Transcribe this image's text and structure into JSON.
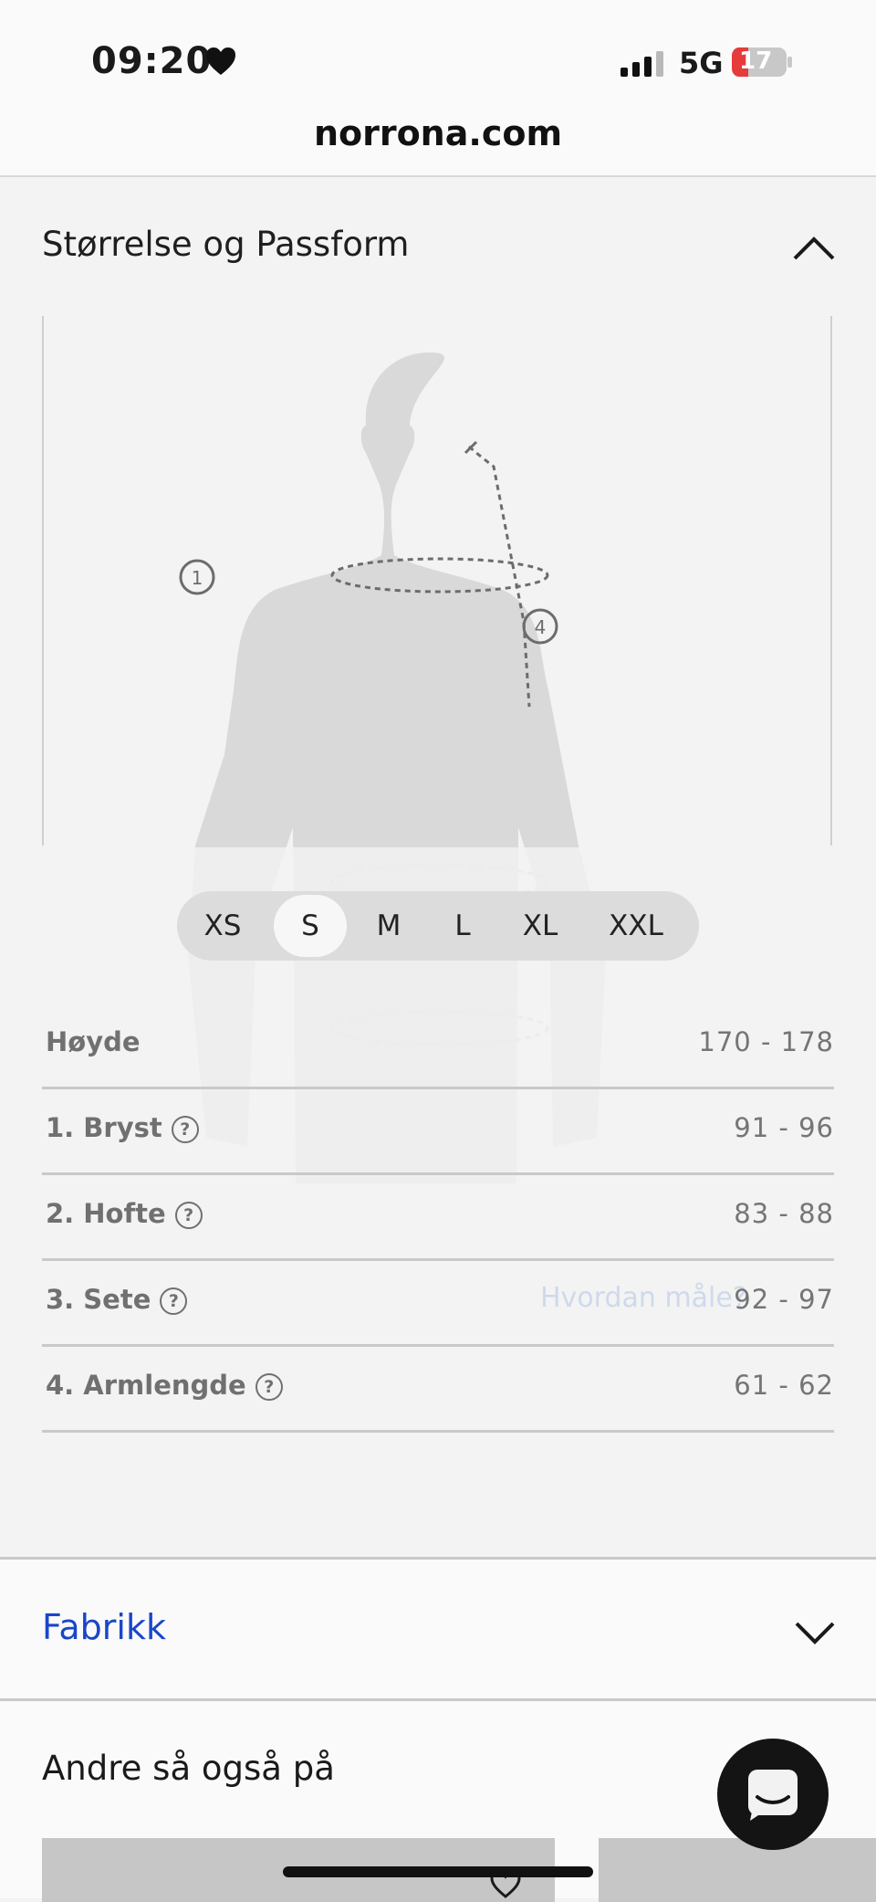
{
  "status_bar": {
    "time": "09:20",
    "network": "5G",
    "battery": "17"
  },
  "browser": {
    "url": "norrona.com"
  },
  "size_fit": {
    "title": "Størrelse og Passform",
    "help_link": "Hvordan måle?",
    "markers": [
      "1",
      "4"
    ],
    "sizes": [
      "XS",
      "S",
      "M",
      "L",
      "XL",
      "XXL"
    ],
    "selected_size": "S",
    "rows": [
      {
        "label": "Høyde",
        "value": "170 - 178"
      },
      {
        "label": "1. Bryst",
        "value": "91 - 96"
      },
      {
        "label": "2. Hofte",
        "value": "83 - 88"
      },
      {
        "label": "3. Sete",
        "value": "92 - 97"
      },
      {
        "label": "4. Armlengde",
        "value": "61 - 62"
      }
    ]
  },
  "fabrikk": {
    "title": "Fabrikk"
  },
  "also_viewed": {
    "title": "Andre så også på"
  },
  "colors": {
    "link_blue": "#1a46c8",
    "chat_bg": "#141414"
  }
}
